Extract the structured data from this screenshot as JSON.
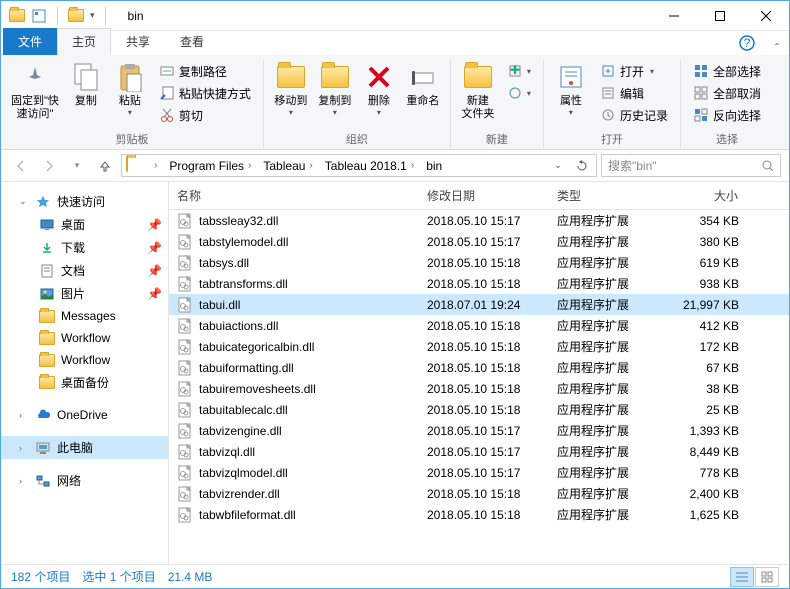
{
  "window": {
    "title": "bin"
  },
  "qat": {
    "dropdown": "▾"
  },
  "tabs": {
    "file": "文件",
    "home": "主页",
    "share": "共享",
    "view": "查看"
  },
  "ribbon": {
    "pin": "固定到\"快\n速访问\"",
    "copy": "复制",
    "paste": "粘贴",
    "copypath": "复制路径",
    "pasteshort": "粘贴快捷方式",
    "cut": "剪切",
    "clipboard": "剪贴板",
    "moveto": "移动到",
    "copyto": "复制到",
    "delete": "删除",
    "rename": "重命名",
    "org": "组织",
    "newfolder": "新建\n文件夹",
    "new": "新建",
    "properties": "属性",
    "open": "打开",
    "edit": "编辑",
    "history": "历史记录",
    "open_group": "打开",
    "selectall": "全部选择",
    "selectnone": "全部取消",
    "invert": "反向选择",
    "select": "选择"
  },
  "breadcrumbs": [
    "Program Files",
    "Tableau",
    "Tableau 2018.1",
    "bin"
  ],
  "search_placeholder": "搜索\"bin\"",
  "nav": {
    "quick": "快速访问",
    "desktop": "桌面",
    "downloads": "下载",
    "documents": "文档",
    "pictures": "图片",
    "messages": "Messages",
    "workflow": "Workflow",
    "desktopbk": "桌面备份",
    "onedrive": "OneDrive",
    "thispc": "此电脑",
    "network": "网络"
  },
  "columns": {
    "name": "名称",
    "date": "修改日期",
    "type": "类型",
    "size": "大小"
  },
  "type_label": "应用程序扩展",
  "files": [
    {
      "n": "tabssleay32.dll",
      "d": "2018.05.10 15:17",
      "s": "354 KB"
    },
    {
      "n": "tabstylemodel.dll",
      "d": "2018.05.10 15:17",
      "s": "380 KB"
    },
    {
      "n": "tabsys.dll",
      "d": "2018.05.10 15:18",
      "s": "619 KB"
    },
    {
      "n": "tabtransforms.dll",
      "d": "2018.05.10 15:18",
      "s": "938 KB"
    },
    {
      "n": "tabui.dll",
      "d": "2018.07.01 19:24",
      "s": "21,997 KB",
      "sel": true
    },
    {
      "n": "tabuiactions.dll",
      "d": "2018.05.10 15:18",
      "s": "412 KB"
    },
    {
      "n": "tabuicategoricalbin.dll",
      "d": "2018.05.10 15:18",
      "s": "172 KB"
    },
    {
      "n": "tabuiformatting.dll",
      "d": "2018.05.10 15:18",
      "s": "67 KB"
    },
    {
      "n": "tabuiremovesheets.dll",
      "d": "2018.05.10 15:18",
      "s": "38 KB"
    },
    {
      "n": "tabuitablecalc.dll",
      "d": "2018.05.10 15:18",
      "s": "25 KB"
    },
    {
      "n": "tabvizengine.dll",
      "d": "2018.05.10 15:17",
      "s": "1,393 KB"
    },
    {
      "n": "tabvizql.dll",
      "d": "2018.05.10 15:17",
      "s": "8,449 KB"
    },
    {
      "n": "tabvizqlmodel.dll",
      "d": "2018.05.10 15:17",
      "s": "778 KB"
    },
    {
      "n": "tabvizrender.dll",
      "d": "2018.05.10 15:18",
      "s": "2,400 KB"
    },
    {
      "n": "tabwbfileformat.dll",
      "d": "2018.05.10 15:18",
      "s": "1,625 KB"
    }
  ],
  "status": {
    "count": "182 个项目",
    "selected": "选中 1 个项目",
    "size": "21.4 MB"
  }
}
